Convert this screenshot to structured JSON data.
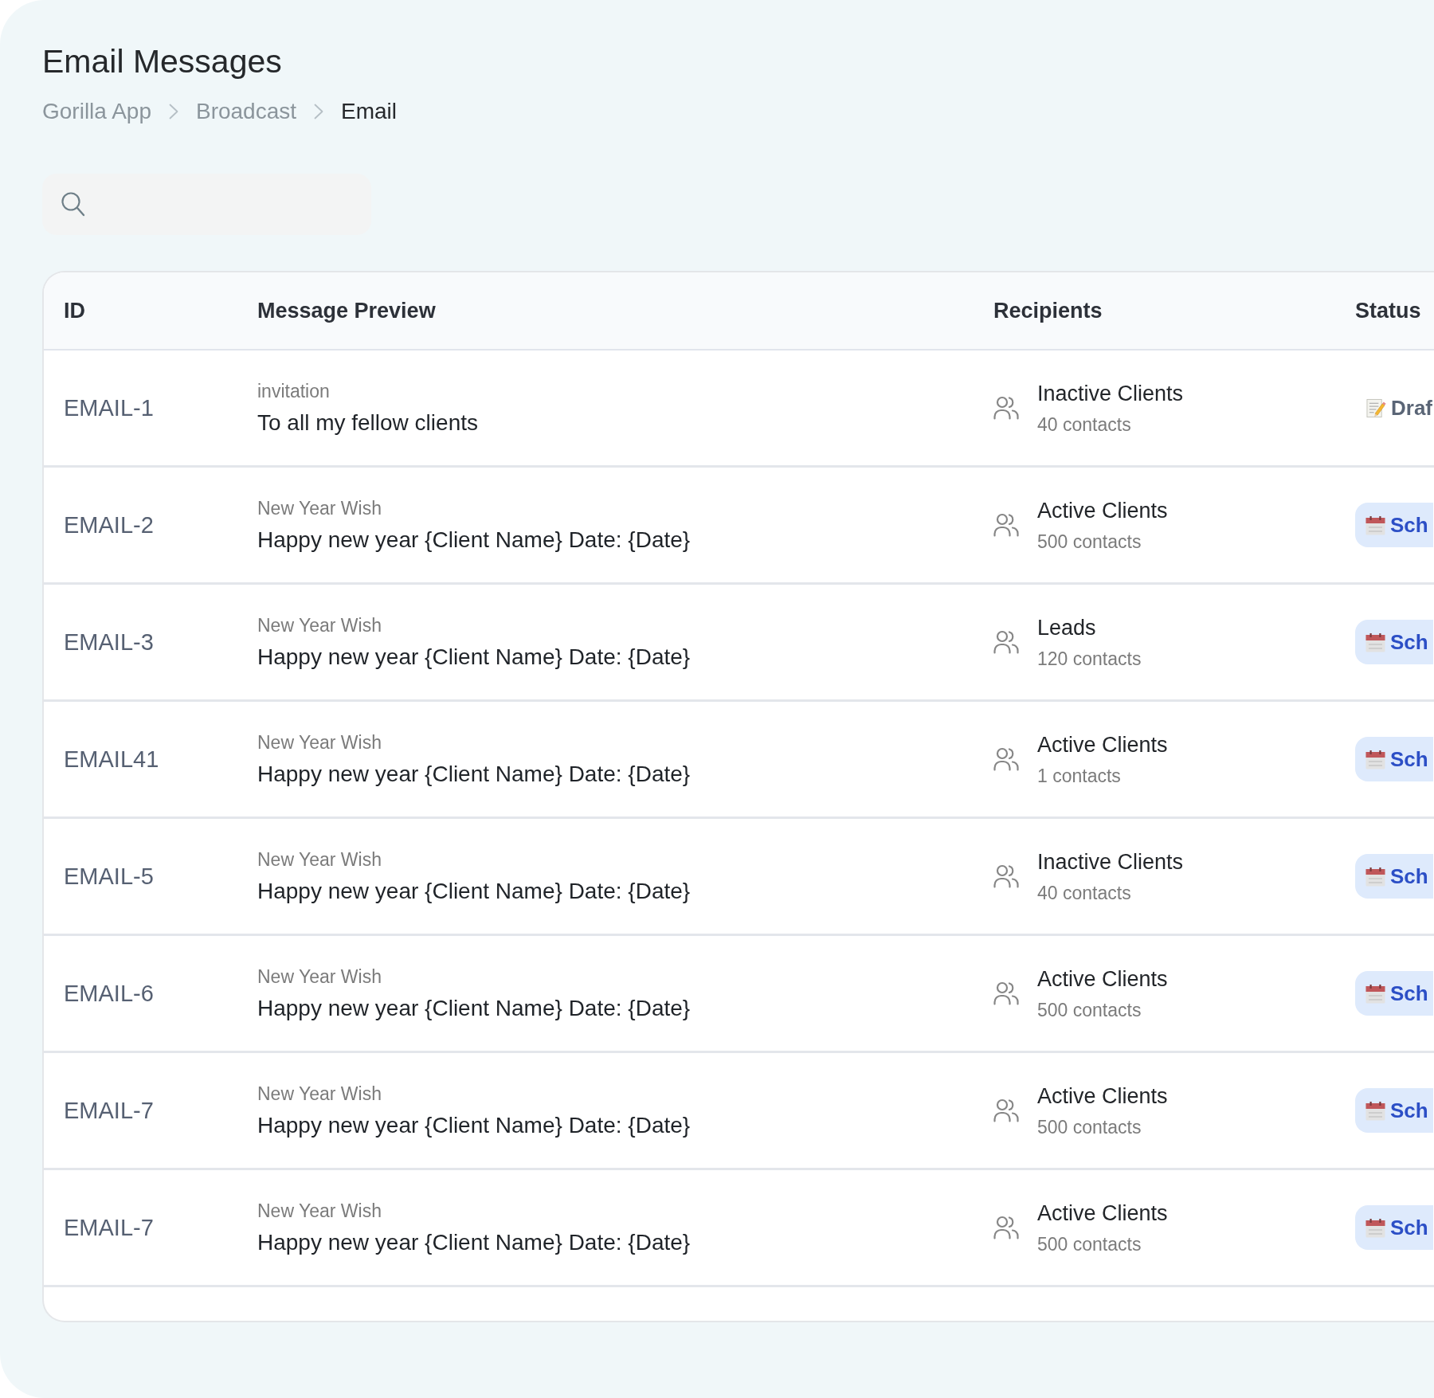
{
  "page": {
    "title": "Email Messages"
  },
  "breadcrumb": [
    {
      "label": "Gorilla App",
      "current": false
    },
    {
      "label": "Broadcast",
      "current": false
    },
    {
      "label": "Email",
      "current": true
    }
  ],
  "table": {
    "columns": [
      "ID",
      "Message Preview",
      "Recipients",
      "Status"
    ],
    "rows": [
      {
        "id": "EMAIL-1",
        "subject": "invitation",
        "message": "To all my fellow clients",
        "recipients": "Inactive Clients",
        "contacts": "40 contacts",
        "status": {
          "kind": "draft",
          "label": "Draf"
        }
      },
      {
        "id": "EMAIL-2",
        "subject": "New Year Wish",
        "message": "Happy new year {Client Name} Date: {Date}",
        "recipients": "Active Clients",
        "contacts": "500 contacts",
        "status": {
          "kind": "scheduled",
          "label": "Sch"
        }
      },
      {
        "id": "EMAIL-3",
        "subject": "New Year Wish",
        "message": "Happy new year {Client Name} Date: {Date}",
        "recipients": "Leads",
        "contacts": "120 contacts",
        "status": {
          "kind": "scheduled",
          "label": "Sch"
        }
      },
      {
        "id": "EMAIL41",
        "subject": "New Year Wish",
        "message": "Happy new year {Client Name} Date: {Date}",
        "recipients": "Active Clients",
        "contacts": "1 contacts",
        "status": {
          "kind": "scheduled",
          "label": "Sch"
        }
      },
      {
        "id": "EMAIL-5",
        "subject": "New Year Wish",
        "message": "Happy new year {Client Name} Date: {Date}",
        "recipients": "Inactive Clients",
        "contacts": "40 contacts",
        "status": {
          "kind": "scheduled",
          "label": "Sch"
        }
      },
      {
        "id": "EMAIL-6",
        "subject": "New Year Wish",
        "message": "Happy new year {Client Name} Date: {Date}",
        "recipients": "Active Clients",
        "contacts": "500 contacts",
        "status": {
          "kind": "scheduled",
          "label": "Sch"
        }
      },
      {
        "id": "EMAIL-7",
        "subject": "New Year Wish",
        "message": "Happy new year {Client Name} Date: {Date}",
        "recipients": "Active Clients",
        "contacts": "500 contacts",
        "status": {
          "kind": "scheduled",
          "label": "Sch"
        }
      },
      {
        "id": "EMAIL-7",
        "subject": "New Year Wish",
        "message": "Happy new year {Client Name} Date: {Date}",
        "recipients": "Active Clients",
        "contacts": "500 contacts",
        "status": {
          "kind": "scheduled",
          "label": "Sch"
        }
      }
    ]
  }
}
